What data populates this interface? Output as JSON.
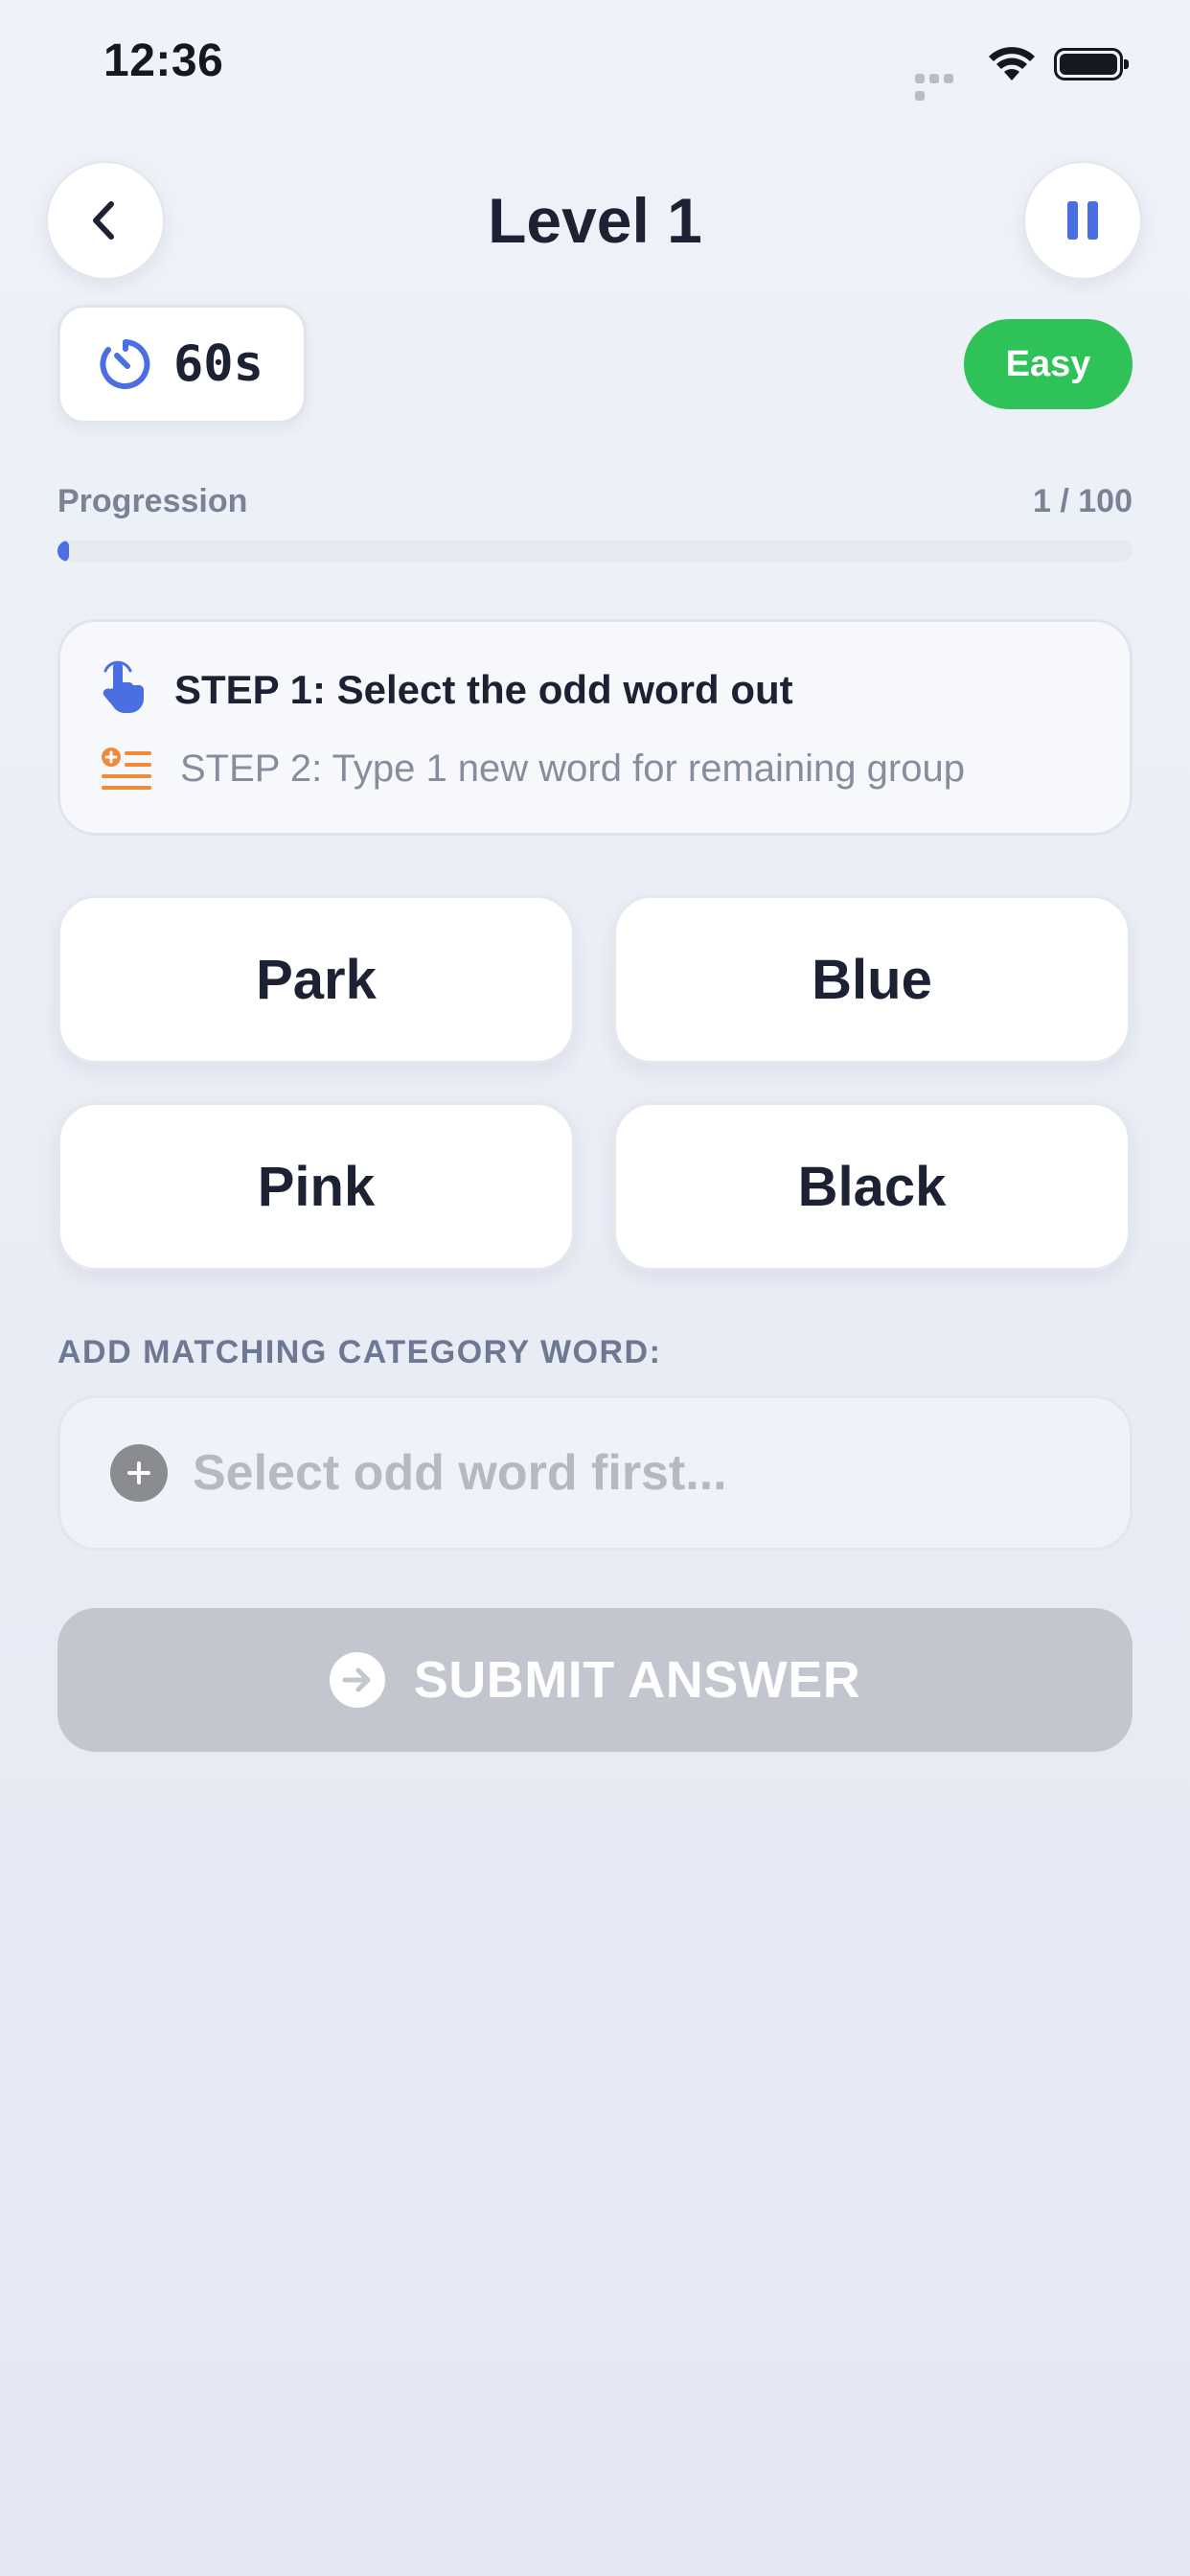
{
  "status_bar": {
    "time": "12:36"
  },
  "header": {
    "title": "Level 1",
    "back_icon": "chevron-left-icon",
    "pause_icon": "pause-icon"
  },
  "timer": {
    "value": "60s",
    "icon": "stopwatch-icon"
  },
  "difficulty": {
    "label": "Easy",
    "color": "#2ec258"
  },
  "progression": {
    "label": "Progression",
    "count_text": "1 / 100",
    "current": 1,
    "total": 100,
    "color": "#4a6fe3"
  },
  "instructions": {
    "step1": "STEP 1: Select the odd word out",
    "step2": "STEP 2: Type 1 new word for remaining group",
    "step1_icon": "pointer-hand-icon",
    "step2_icon": "list-add-icon"
  },
  "words": [
    "Park",
    "Blue",
    "Pink",
    "Black"
  ],
  "answer": {
    "label": "ADD MATCHING CATEGORY WORD:",
    "placeholder": "Select odd word first...",
    "value": ""
  },
  "submit": {
    "label": "SUBMIT ANSWER",
    "icon": "arrow-right-circle-icon",
    "enabled": false
  },
  "colors": {
    "accent": "#4a6fe3",
    "step2_icon": "#ef8a3a",
    "disabled_button": "#c3c6cf"
  }
}
